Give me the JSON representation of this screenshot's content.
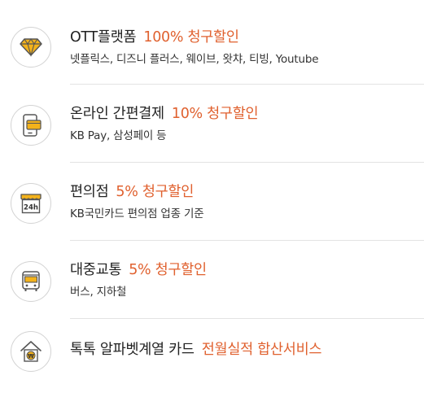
{
  "benefits": [
    {
      "icon": "diamond-icon",
      "name": "OTT플랫폼",
      "benefit": "100% 청구할인",
      "detail": "넷플릭스, 디즈니 플러스, 웨이브, 왓챠, 티빙, Youtube"
    },
    {
      "icon": "mobile-payment-icon",
      "name": "온라인 간편결제",
      "benefit": "10% 청구할인",
      "detail": "KB Pay, 삼성페이 등"
    },
    {
      "icon": "convenience-store-24h-icon",
      "name": "편의점",
      "benefit": "5% 청구할인",
      "detail": "KB국민카드 편의점 업종 기준"
    },
    {
      "icon": "bus-icon",
      "name": "대중교통",
      "benefit": "5% 청구할인",
      "detail": "버스, 지하철"
    },
    {
      "icon": "house-won-icon",
      "name": "톡톡 알파벳계열 카드",
      "benefit": "전월실적 합산서비스",
      "detail": ""
    }
  ],
  "icon_labels": {
    "store_sign": "24h",
    "won_sign": "₩"
  },
  "colors": {
    "accent": "#e0612f",
    "icon_gold": "#f3b21b",
    "icon_stroke": "#555555",
    "divider": "#e3e3e3"
  }
}
